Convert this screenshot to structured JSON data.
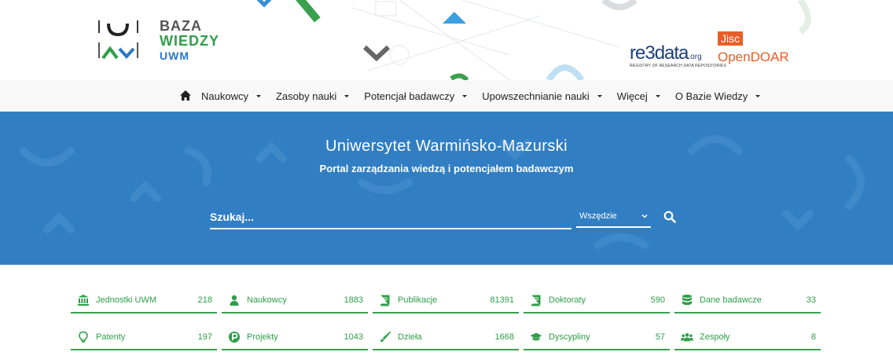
{
  "header": {
    "logo_line1": "BAZA",
    "logo_line2": "WIEDZY",
    "logo_line3": "UWM",
    "re3data_main": "re3data",
    "re3data_org": ".org",
    "re3data_tagline": "REGISTRY OF RESEARCH DATA REPOSITORIES",
    "jisc": "Jisc",
    "opendoar": "OpenDOAR"
  },
  "nav": {
    "home_icon": "home-icon",
    "items": [
      {
        "label": "Naukowcy"
      },
      {
        "label": "Zasoby nauki"
      },
      {
        "label": "Potencjał badawczy"
      },
      {
        "label": "Upowszechnianie nauki"
      },
      {
        "label": "Więcej"
      },
      {
        "label": "O Bazie Wiedzy"
      }
    ]
  },
  "hero": {
    "title": "Uniwersytet Warmińsko-Mazurski",
    "subtitle": "Portal zarządzania wiedzą i potencjałem badawczym",
    "search_placeholder": "Szukaj...",
    "scope_value": "Wszędzie",
    "search_icon": "search-icon"
  },
  "colors": {
    "hero_bg": "#317ec3",
    "accent_green": "#2e9e48",
    "nav_bg": "#f8f8f8"
  },
  "stats": [
    {
      "label": "Jednostki UWM",
      "count": "218",
      "icon": "institution-icon"
    },
    {
      "label": "Naukowcy",
      "count": "1883",
      "icon": "user-icon"
    },
    {
      "label": "Publikacje",
      "count": "81391",
      "icon": "book-icon"
    },
    {
      "label": "Doktoraty",
      "count": "590",
      "icon": "book-icon"
    },
    {
      "label": "Dane badawcze",
      "count": "33",
      "icon": "database-icon"
    },
    {
      "label": "Patenty",
      "count": "197",
      "icon": "lightbulb-icon"
    },
    {
      "label": "Projekty",
      "count": "1043",
      "icon": "project-icon"
    },
    {
      "label": "Dzieła",
      "count": "1668",
      "icon": "brush-icon"
    },
    {
      "label": "Dyscypliny",
      "count": "57",
      "icon": "graduation-cap-icon"
    },
    {
      "label": "Zespoły",
      "count": "8",
      "icon": "team-icon"
    }
  ]
}
